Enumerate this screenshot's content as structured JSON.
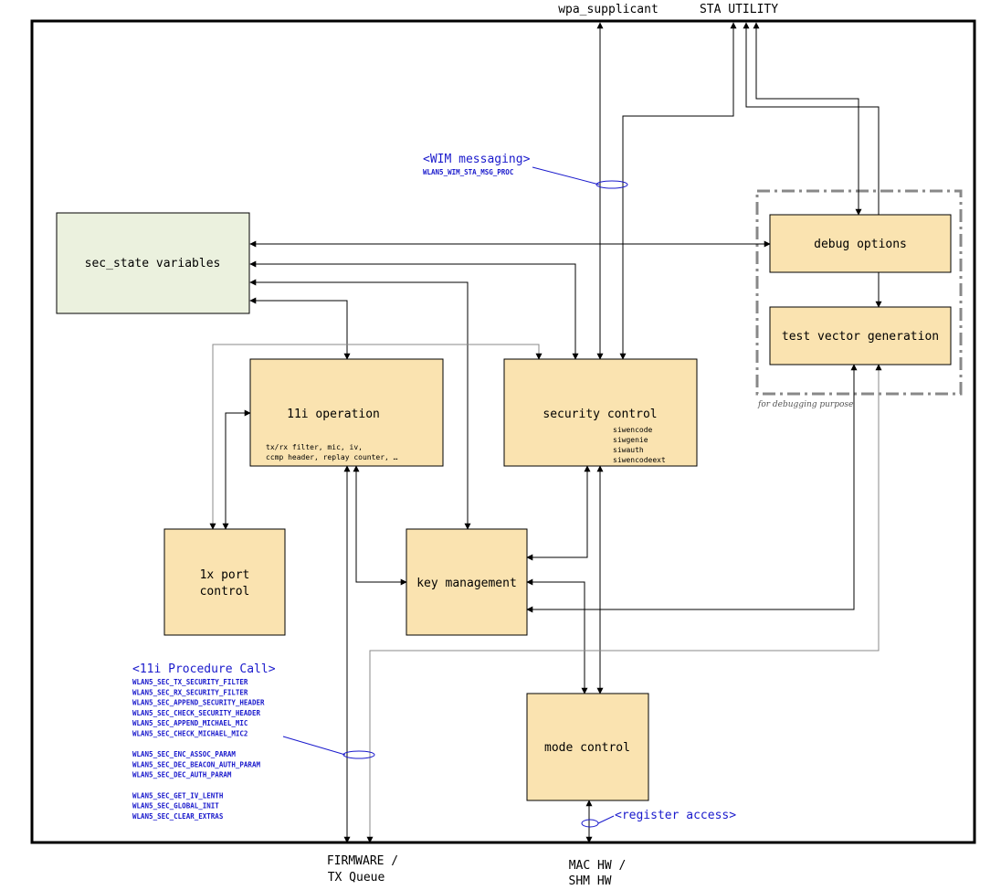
{
  "external": {
    "wpa_supplicant": "wpa_supplicant",
    "sta_utility": "STA UTILITY",
    "firmware": [
      "FIRMWARE /",
      "TX Queue"
    ],
    "mac_hw": [
      "MAC HW /",
      "SHM HW"
    ]
  },
  "blocks": {
    "sec_state": "sec_state variables",
    "debug_options": "debug options",
    "test_vector": "test vector generation",
    "debug_group_label": "for debugging purpose",
    "op_11i": "11i operation",
    "op_11i_details": [
      "tx/rx filter, mic, iv,",
      "ccmp header, replay counter, …"
    ],
    "security_control": "security control",
    "security_control_details": [
      "siwencode",
      "siwgenie",
      "siwauth",
      "siwencodeext"
    ],
    "port_control": [
      "1x port",
      "control"
    ],
    "key_management": "key management",
    "mode_control": "mode control"
  },
  "annotations": {
    "wim_title": "<WIM messaging>",
    "wim_items": [
      "WLAN5_WIM_STA_MSG_PROC"
    ],
    "proc_title": "<11i Procedure Call>",
    "proc_items": [
      "WLAN5_SEC_TX_SECURITY_FILTER",
      "WLAN5_SEC_RX_SECURITY_FILTER",
      "WLAN5_SEC_APPEND_SECURITY_HEADER",
      "WLAN5_SEC_CHECK_SECURITY_HEADER",
      "WLAN5_SEC_APPEND_MICHAEL_MIC",
      "WLAN5_SEC_CHECK_MICHAEL_MIC2",
      "",
      "WLAN5_SEC_ENC_ASSOC_PARAM",
      "WLAN5_SEC_DEC_BEACON_AUTH_PARAM",
      "WLAN5_SEC_DEC_AUTH_PARAM",
      "",
      "WLAN5_SEC_GET_IV_LENTH",
      "WLAN5_SEC_GLOBAL_INIT",
      "WLAN5_SEC_CLEAR_EXTRAS"
    ],
    "register_access": "<register access>"
  },
  "colors": {
    "block_fill": "#fae3b0",
    "state_fill": "#ebf1de",
    "annotation": "#1a1acc",
    "debug_border": "#888888"
  }
}
